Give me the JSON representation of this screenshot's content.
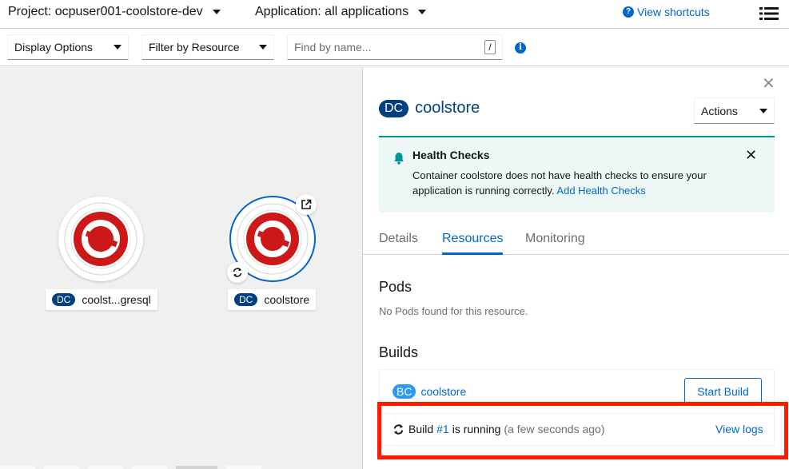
{
  "topbar": {
    "project_label": "Project: ocpuser001-coolstore-dev",
    "application_label": "Application: all applications",
    "shortcuts_label": "View shortcuts"
  },
  "toolbar": {
    "display_options": "Display Options",
    "filter_by_resource": "Filter by Resource",
    "search_placeholder": "Find by name...",
    "search_shortcut": "/"
  },
  "topology": {
    "nodes": [
      {
        "badge": "DC",
        "label": "coolst...gresql"
      },
      {
        "badge": "DC",
        "label": "coolstore"
      }
    ]
  },
  "panel": {
    "badge": "DC",
    "title": "coolstore",
    "actions_label": "Actions",
    "alert": {
      "title": "Health Checks",
      "body": "Container coolstore does not have health checks to ensure your application is running correctly.",
      "link": "Add Health Checks"
    },
    "tabs": [
      "Details",
      "Resources",
      "Monitoring"
    ],
    "active_tab": "Resources",
    "pods_heading": "Pods",
    "pods_empty": "No Pods found for this resource.",
    "builds_heading": "Builds",
    "build_config": {
      "badge": "BC",
      "name": "coolstore"
    },
    "start_build_label": "Start Build",
    "build_status": {
      "prefix": "Build",
      "number": "#1",
      "status": "is running",
      "ago": "(a few seconds ago)"
    },
    "view_logs_label": "View logs"
  },
  "colors": {
    "accent": "#0066cc",
    "dc_badge": "#004080",
    "bc_badge": "#2b9af3",
    "highlight": "#ff1a00",
    "alert_bg": "#edf8f6",
    "openshift_red": "#cc1818"
  }
}
